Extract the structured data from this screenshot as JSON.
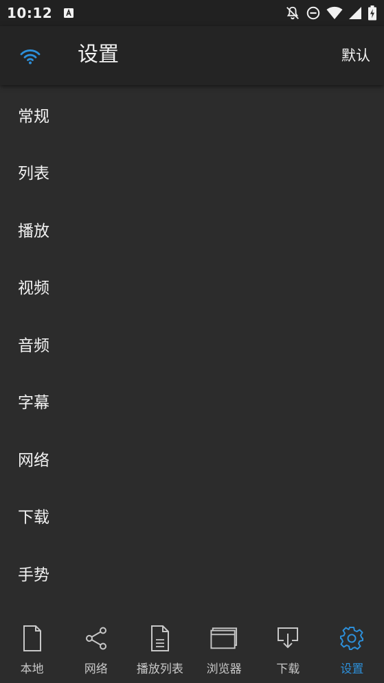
{
  "status_bar": {
    "time": "10:12",
    "icons": [
      "notification-a-icon",
      "bell-off-icon",
      "do-not-disturb-icon",
      "wifi-signal-icon",
      "cell-signal-icon",
      "battery-charging-icon"
    ]
  },
  "app_bar": {
    "title": "设置",
    "action_label": "默认",
    "icon": "wifi-icon",
    "accent": "#2d8fd9"
  },
  "menu": {
    "items": [
      {
        "label": "常规"
      },
      {
        "label": "列表"
      },
      {
        "label": "播放"
      },
      {
        "label": "视频"
      },
      {
        "label": "音频"
      },
      {
        "label": "字幕"
      },
      {
        "label": "网络"
      },
      {
        "label": "下载"
      },
      {
        "label": "手势"
      }
    ]
  },
  "bottom_nav": {
    "items": [
      {
        "label": "本地",
        "icon": "file-icon"
      },
      {
        "label": "网络",
        "icon": "share-icon"
      },
      {
        "label": "播放列表",
        "icon": "document-list-icon"
      },
      {
        "label": "浏览器",
        "icon": "browser-window-icon"
      },
      {
        "label": "下载",
        "icon": "download-tray-icon"
      },
      {
        "label": "设置",
        "icon": "gear-icon",
        "active": true
      }
    ],
    "active_color": "#2d8fd9",
    "inactive_color": "#c8c8c8"
  },
  "colors": {
    "background": "#2c2c2c",
    "app_bar": "#242424",
    "status_bar": "#212121",
    "text": "#f2f2f2"
  }
}
